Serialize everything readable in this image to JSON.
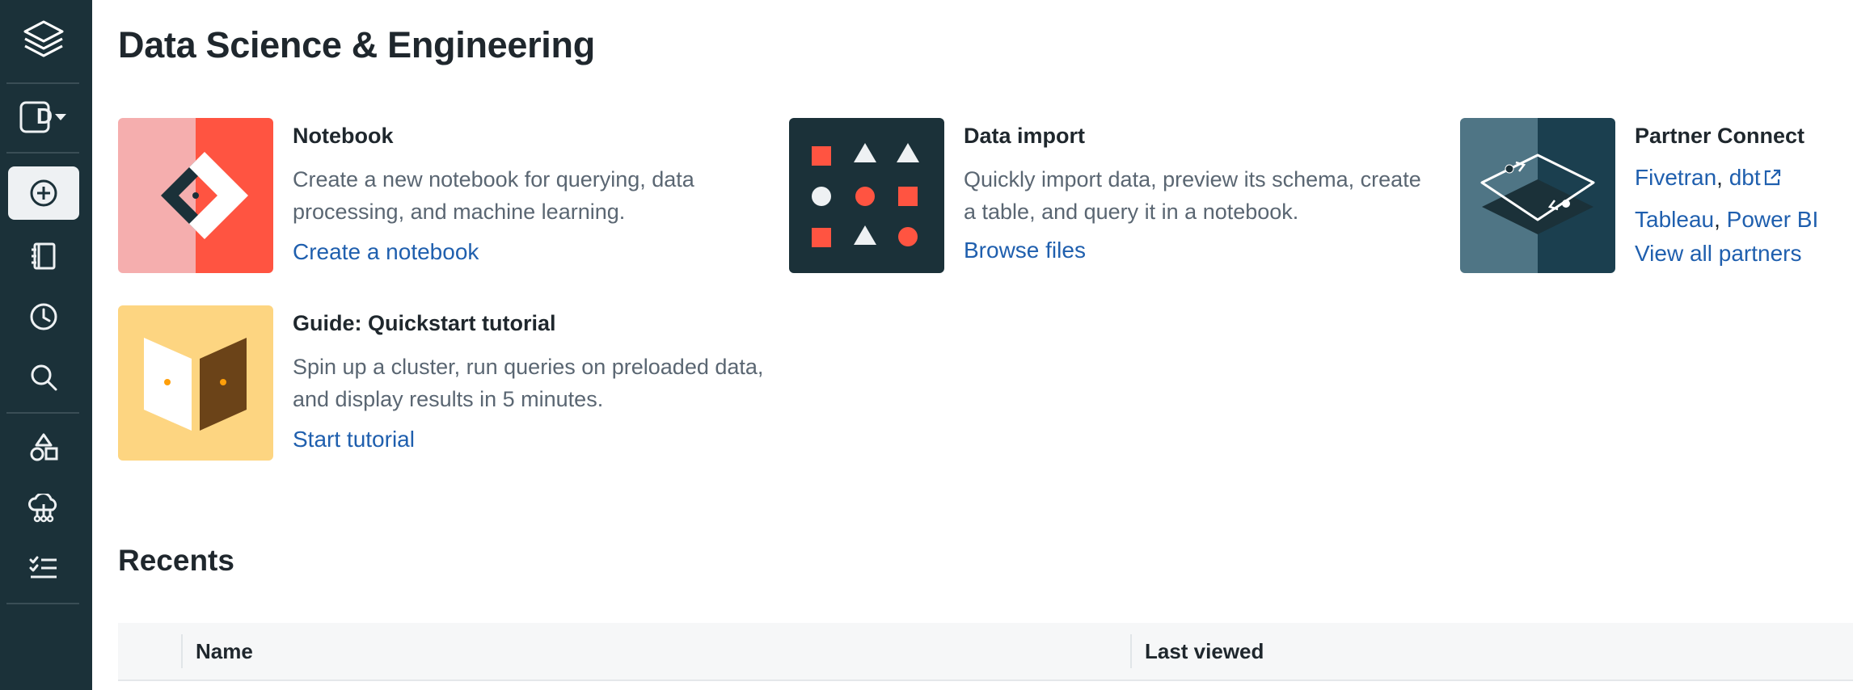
{
  "page": {
    "title": "Data Science & Engineering"
  },
  "sidebar": {
    "persona_letter": "D",
    "items": [
      {
        "icon": "layers-logo-icon"
      },
      {
        "icon": "persona-switcher-icon"
      },
      {
        "icon": "create-plus-icon"
      },
      {
        "icon": "workspace-notebook-icon"
      },
      {
        "icon": "recents-clock-icon"
      },
      {
        "icon": "search-icon"
      },
      {
        "icon": "shapes-data-icon"
      },
      {
        "icon": "compute-cloud-icon"
      },
      {
        "icon": "workflows-checklist-icon"
      }
    ]
  },
  "cards": {
    "notebook": {
      "title": "Notebook",
      "description": "Create a new notebook for querying, data processing, and machine learning.",
      "link": "Create a notebook",
      "colors": {
        "bg_left": "#f5aeae",
        "bg_right": "#ff5441",
        "dark": "#1b3139"
      }
    },
    "data_import": {
      "title": "Data import",
      "description": "Quickly import data, preview its schema, create a table, and query it in a notebook.",
      "link": "Browse files",
      "colors": {
        "bg": "#1b3139",
        "accent": "#ff5441",
        "light": "#eef1f3"
      }
    },
    "partner_connect": {
      "title": "Partner Connect",
      "partners_line1": [
        "Fivetran",
        "dbt"
      ],
      "partners_line2": [
        "Tableau",
        "Power BI"
      ],
      "link": "View all partners",
      "colors": {
        "bg_left": "#4f7585",
        "bg_right": "#1b3f4f"
      }
    },
    "guide": {
      "title": "Guide: Quickstart tutorial",
      "description": "Spin up a cluster, run queries on preloaded data, and display results in 5 minutes.",
      "link": "Start tutorial",
      "colors": {
        "bg": "#fdd581",
        "brown": "#6b4318",
        "dot": "#ff9f0a"
      }
    }
  },
  "recents": {
    "title": "Recents",
    "columns": [
      "Name",
      "Last viewed"
    ]
  },
  "colors": {
    "link": "#1f5fae",
    "sidebar_bg": "#1b3139",
    "text": "#1f272d",
    "muted": "#5a6672"
  }
}
